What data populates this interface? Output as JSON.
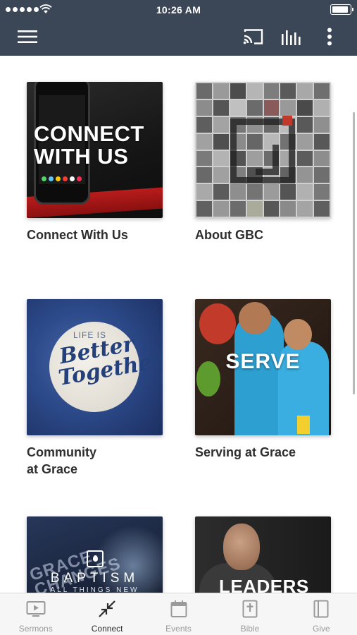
{
  "status_bar": {
    "time": "10:26 AM"
  },
  "header": {
    "icons": [
      "menu-icon",
      "cast-icon",
      "audio-bars-icon",
      "more-vertical-icon"
    ]
  },
  "tiles": [
    {
      "label": "Connect With Us",
      "image_text": "CONNECT WITH US"
    },
    {
      "label": "About GBC"
    },
    {
      "label": "Community\nat Grace",
      "image_text_top": "LIFE IS",
      "image_text_script": "Better Together."
    },
    {
      "label": "Serving at Grace",
      "image_text": "SERVE"
    },
    {
      "label": "",
      "image_text": "BAPTISM",
      "image_subtext": "ALL THINGS NEW",
      "image_background_text": "GRACE CHANGES"
    },
    {
      "label": "",
      "image_text": "LEADERS"
    }
  ],
  "tabbar": {
    "active": "Connect",
    "tabs": [
      {
        "label": "Sermons",
        "icon": "video-player-icon"
      },
      {
        "label": "Connect",
        "icon": "arrows-inward-icon"
      },
      {
        "label": "Events",
        "icon": "calendar-icon"
      },
      {
        "label": "Bible",
        "icon": "bible-icon"
      },
      {
        "label": "Give",
        "icon": "give-book-icon"
      }
    ]
  },
  "colors": {
    "header": "#3b4656",
    "tab_active": "#2d2d2d",
    "tab_inactive": "#9a9a9a"
  }
}
